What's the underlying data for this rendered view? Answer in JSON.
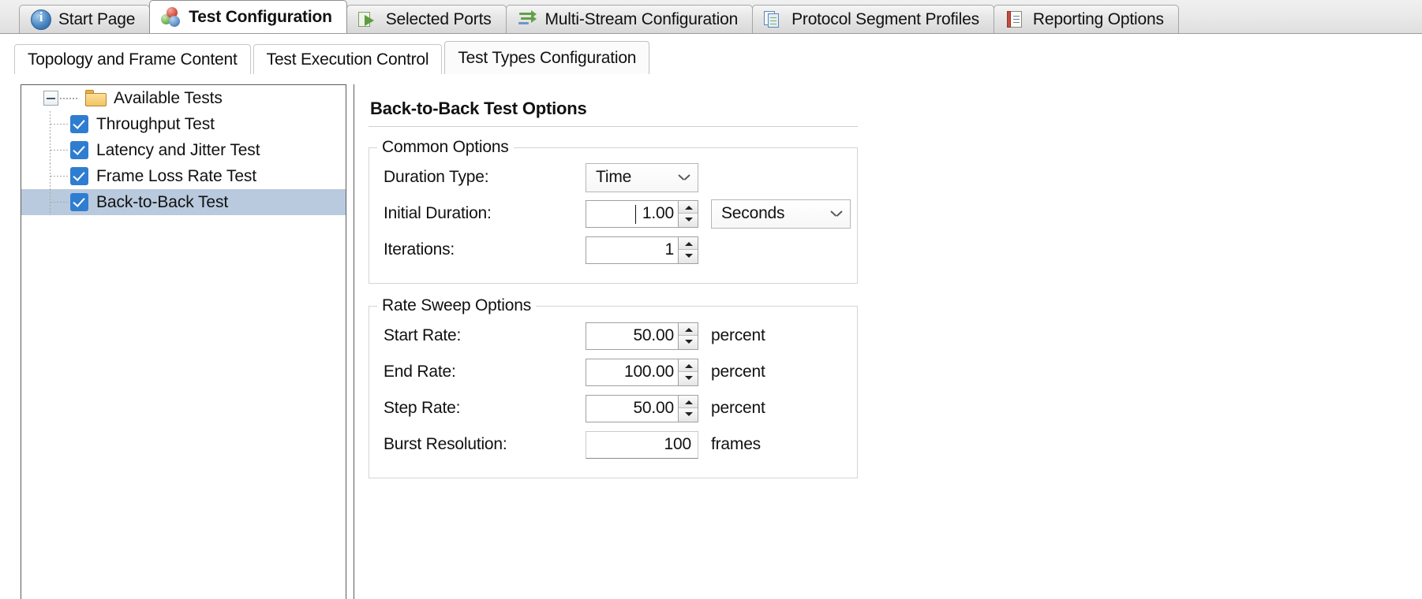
{
  "tabs": [
    {
      "label": "Start Page",
      "icon": "info-circle-icon",
      "active": false
    },
    {
      "label": "Test Configuration",
      "icon": "spheres-icon",
      "active": true
    },
    {
      "label": "Selected Ports",
      "icon": "ports-arrow-icon",
      "active": false
    },
    {
      "label": "Multi-Stream Configuration",
      "icon": "multi-stream-icon",
      "active": false
    },
    {
      "label": "Protocol Segment Profiles",
      "icon": "documents-icon",
      "active": false
    },
    {
      "label": "Reporting Options",
      "icon": "report-book-icon",
      "active": false
    }
  ],
  "subtabs": [
    {
      "label": "Topology and Frame Content",
      "active": false
    },
    {
      "label": "Test Execution Control",
      "active": false
    },
    {
      "label": "Test Types Configuration",
      "active": true
    }
  ],
  "tree": {
    "root": {
      "label": "Available Tests",
      "expanded": true,
      "icon": "folder-icon"
    },
    "items": [
      {
        "label": "Throughput Test",
        "checked": true,
        "selected": false
      },
      {
        "label": "Latency and Jitter Test",
        "checked": true,
        "selected": false
      },
      {
        "label": "Frame Loss Rate Test",
        "checked": true,
        "selected": false
      },
      {
        "label": "Back-to-Back Test",
        "checked": true,
        "selected": true
      }
    ]
  },
  "panel": {
    "title": "Back-to-Back Test Options",
    "common": {
      "legend": "Common Options",
      "duration_type_label": "Duration Type:",
      "duration_type_value": "Time",
      "initial_duration_label": "Initial Duration:",
      "initial_duration_value": "1.00",
      "initial_duration_unit": "Seconds",
      "iterations_label": "Iterations:",
      "iterations_value": "1"
    },
    "sweep": {
      "legend": "Rate Sweep Options",
      "start_rate_label": "Start Rate:",
      "start_rate_value": "50.00",
      "start_rate_unit": "percent",
      "end_rate_label": "End Rate:",
      "end_rate_value": "100.00",
      "end_rate_unit": "percent",
      "step_rate_label": "Step Rate:",
      "step_rate_value": "50.00",
      "step_rate_unit": "percent",
      "burst_resolution_label": "Burst Resolution:",
      "burst_resolution_value": "100",
      "burst_resolution_unit": "frames"
    }
  },
  "colors": {
    "checkbox_blue": "#2f7dd1",
    "selection_blue": "#b9cade",
    "folder_gold": "#f2c462"
  }
}
